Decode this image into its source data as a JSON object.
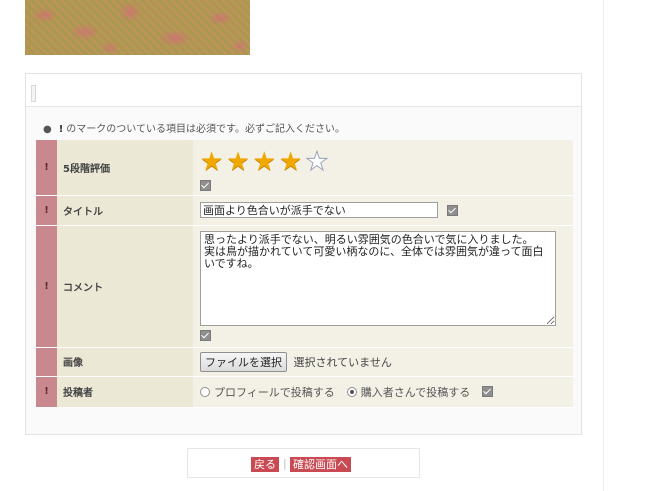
{
  "notice": {
    "mark": "!",
    "text": "のマークのついている項目は必須です。必ずご記入ください。"
  },
  "rows": {
    "rating": {
      "required_mark": "!",
      "label": "5段階評価",
      "value": 4,
      "max": 5
    },
    "title": {
      "required_mark": "!",
      "label": "タイトル",
      "value": "画面より色合いが派手でない"
    },
    "comment": {
      "required_mark": "!",
      "label": "コメント",
      "value": "思ったより派手でない、明るい雰囲気の色合いで気に入りました。\n実は鳥が描かれていて可愛い柄なのに、全体では雰囲気が違って面白いですね。"
    },
    "image": {
      "label": "画像",
      "button": "ファイルを選択",
      "status": "選択されていません"
    },
    "poster": {
      "required_mark": "!",
      "label": "投稿者",
      "options": [
        "プロフィールで投稿する",
        "購入者さんで投稿する"
      ],
      "selected": "購入者さんで投稿する"
    }
  },
  "buttons": {
    "back": "戻る",
    "confirm": "確認画面へ"
  },
  "colors": {
    "required": "#c9888e",
    "label_bg": "#ece8d6",
    "button": "#c94a52",
    "star": "#f0a800"
  }
}
